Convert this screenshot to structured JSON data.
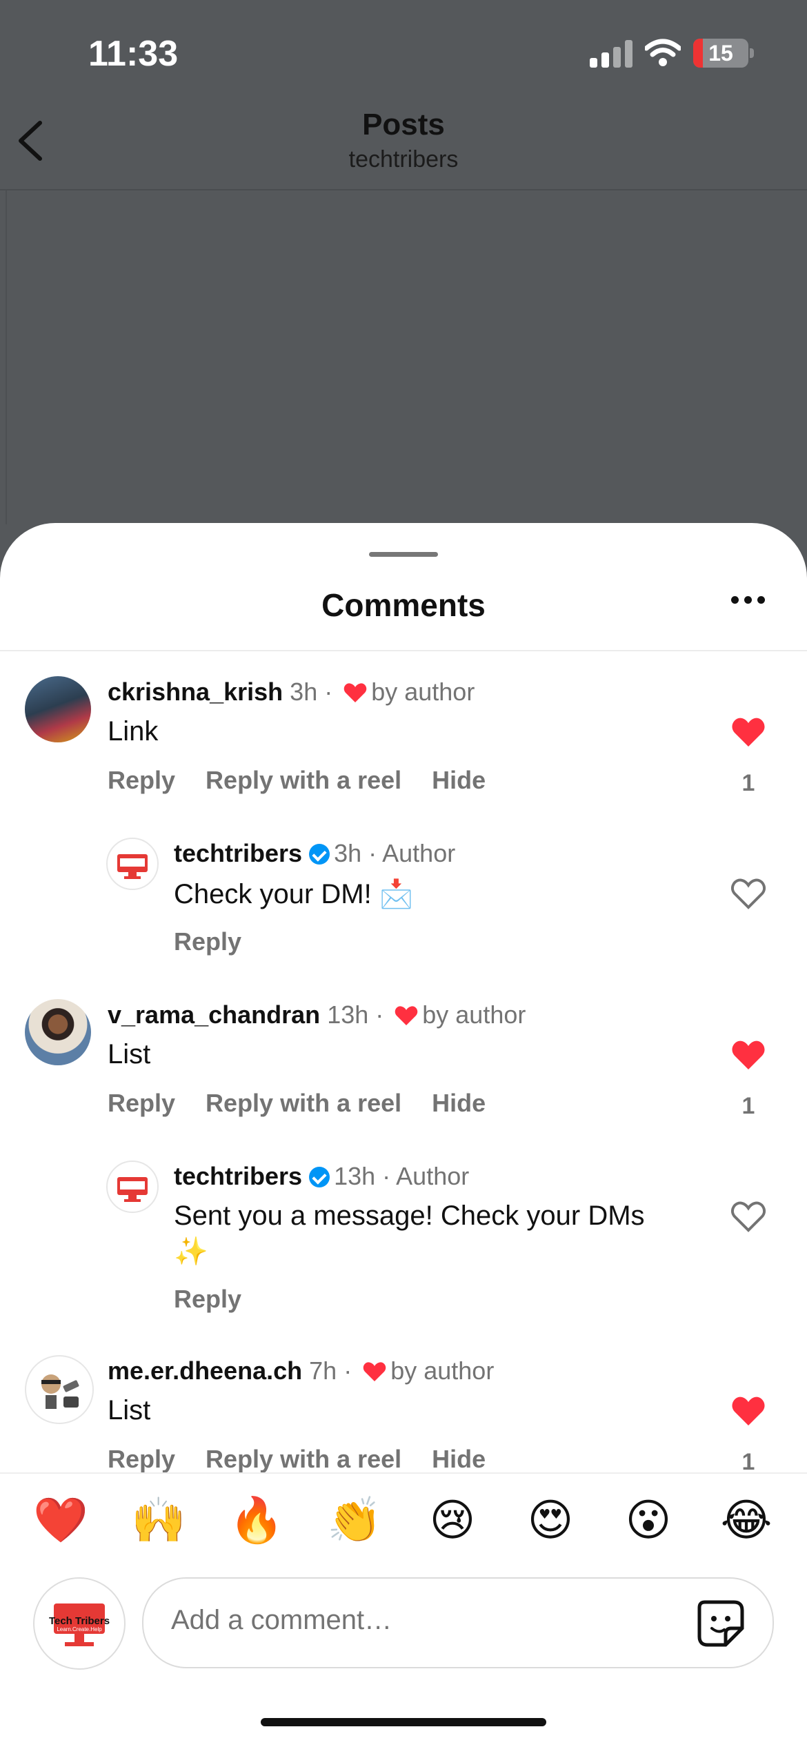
{
  "status_bar": {
    "time": "11:33",
    "battery": "15"
  },
  "header": {
    "title": "Posts",
    "subtitle": "techtribers"
  },
  "sheet": {
    "title": "Comments"
  },
  "comments": [
    {
      "user": "ckrishna_krish",
      "time": "3h",
      "liked_by": "by author",
      "text": "Link",
      "actions": [
        "Reply",
        "Reply with a reel",
        "Hide"
      ],
      "likes": "1"
    },
    {
      "user": "techtribers",
      "time": "3h",
      "tag": "Author",
      "text": "Check your DM! 📩",
      "actions": [
        "Reply"
      ]
    },
    {
      "user": "v_rama_chandran",
      "time": "13h",
      "liked_by": "by author",
      "text": "List",
      "actions": [
        "Reply",
        "Reply with a reel",
        "Hide"
      ],
      "likes": "1"
    },
    {
      "user": "techtribers",
      "time": "13h",
      "tag": "Author",
      "text": "Sent you a message! Check your DMs",
      "text2": "✨",
      "actions": [
        "Reply"
      ]
    },
    {
      "user": "me.er.dheena.ch",
      "time": "7h",
      "liked_by": "by author",
      "text": "List",
      "actions": [
        "Reply",
        "Reply with a reel",
        "Hide"
      ],
      "likes": "1"
    }
  ],
  "emojis": [
    "❤️",
    "🙌",
    "🔥",
    "👏",
    "😢",
    "😍",
    "😮",
    "😂"
  ],
  "composer": {
    "placeholder": "Add a comment…",
    "avatar_brand": "Tech Tribers",
    "avatar_tagline": "Learn.Create.Help"
  },
  "colors": {
    "like_red": "#ff3040",
    "verified_blue": "#0095f6",
    "brand_red": "#e53935"
  }
}
